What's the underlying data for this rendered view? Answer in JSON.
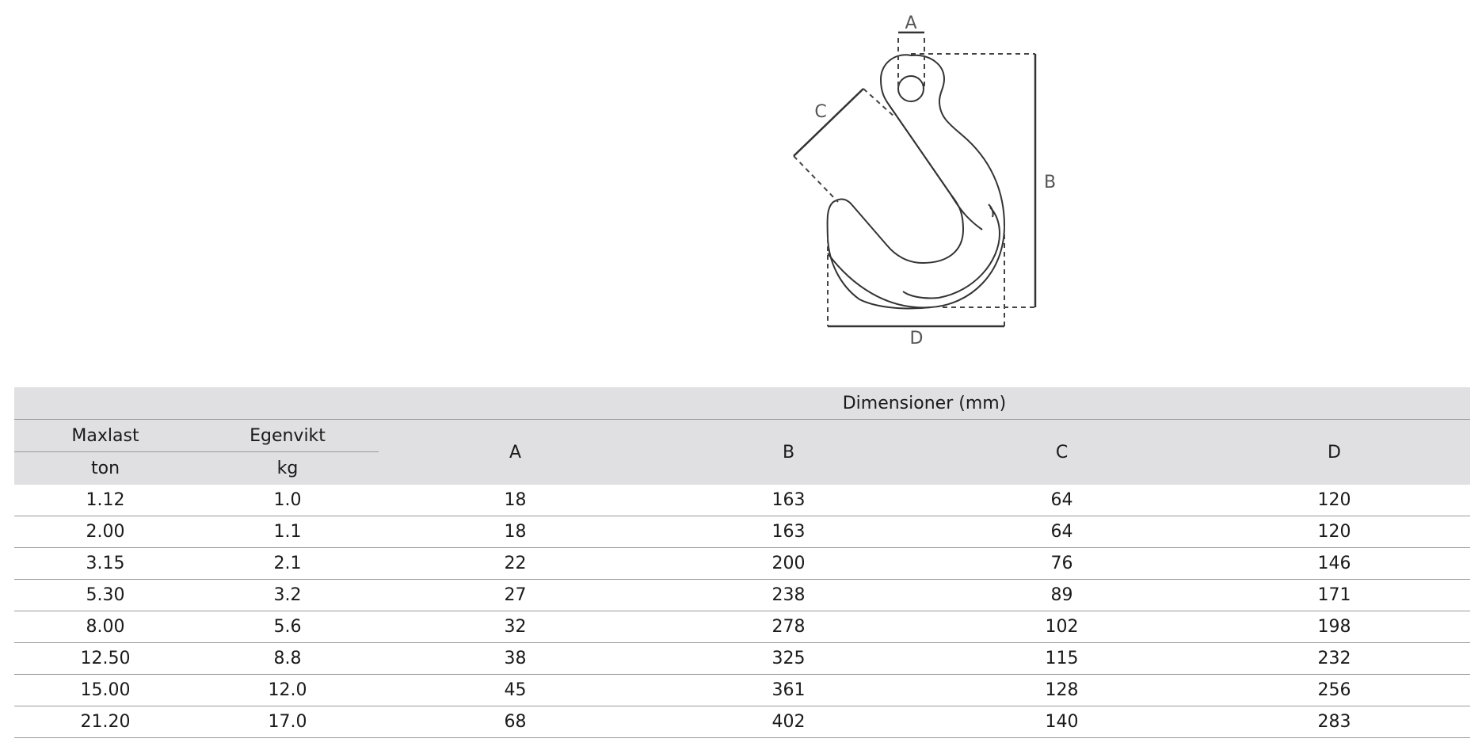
{
  "diagram": {
    "label_a": "A",
    "label_b": "B",
    "label_c": "C",
    "label_d": "D"
  },
  "table": {
    "group_header": "Dimensioner (mm)",
    "maxlast_label": "Maxlast",
    "maxlast_unit": "ton",
    "egenvikt_label": "Egenvikt",
    "egenvikt_unit": "kg",
    "col_a": "A",
    "col_b": "B",
    "col_c": "C",
    "col_d": "D",
    "rows": [
      {
        "maxlast": "1.12",
        "egenvikt": "1.0",
        "a": "18",
        "b": "163",
        "c": "64",
        "d": "120"
      },
      {
        "maxlast": "2.00",
        "egenvikt": "1.1",
        "a": "18",
        "b": "163",
        "c": "64",
        "d": "120"
      },
      {
        "maxlast": "3.15",
        "egenvikt": "2.1",
        "a": "22",
        "b": "200",
        "c": "76",
        "d": "146"
      },
      {
        "maxlast": "5.30",
        "egenvikt": "3.2",
        "a": "27",
        "b": "238",
        "c": "89",
        "d": "171"
      },
      {
        "maxlast": "8.00",
        "egenvikt": "5.6",
        "a": "32",
        "b": "278",
        "c": "102",
        "d": "198"
      },
      {
        "maxlast": "12.50",
        "egenvikt": "8.8",
        "a": "38",
        "b": "325",
        "c": "115",
        "d": "232"
      },
      {
        "maxlast": "15.00",
        "egenvikt": "12.0",
        "a": "45",
        "b": "361",
        "c": "128",
        "d": "256"
      },
      {
        "maxlast": "21.20",
        "egenvikt": "17.0",
        "a": "68",
        "b": "402",
        "c": "140",
        "d": "283"
      }
    ]
  }
}
